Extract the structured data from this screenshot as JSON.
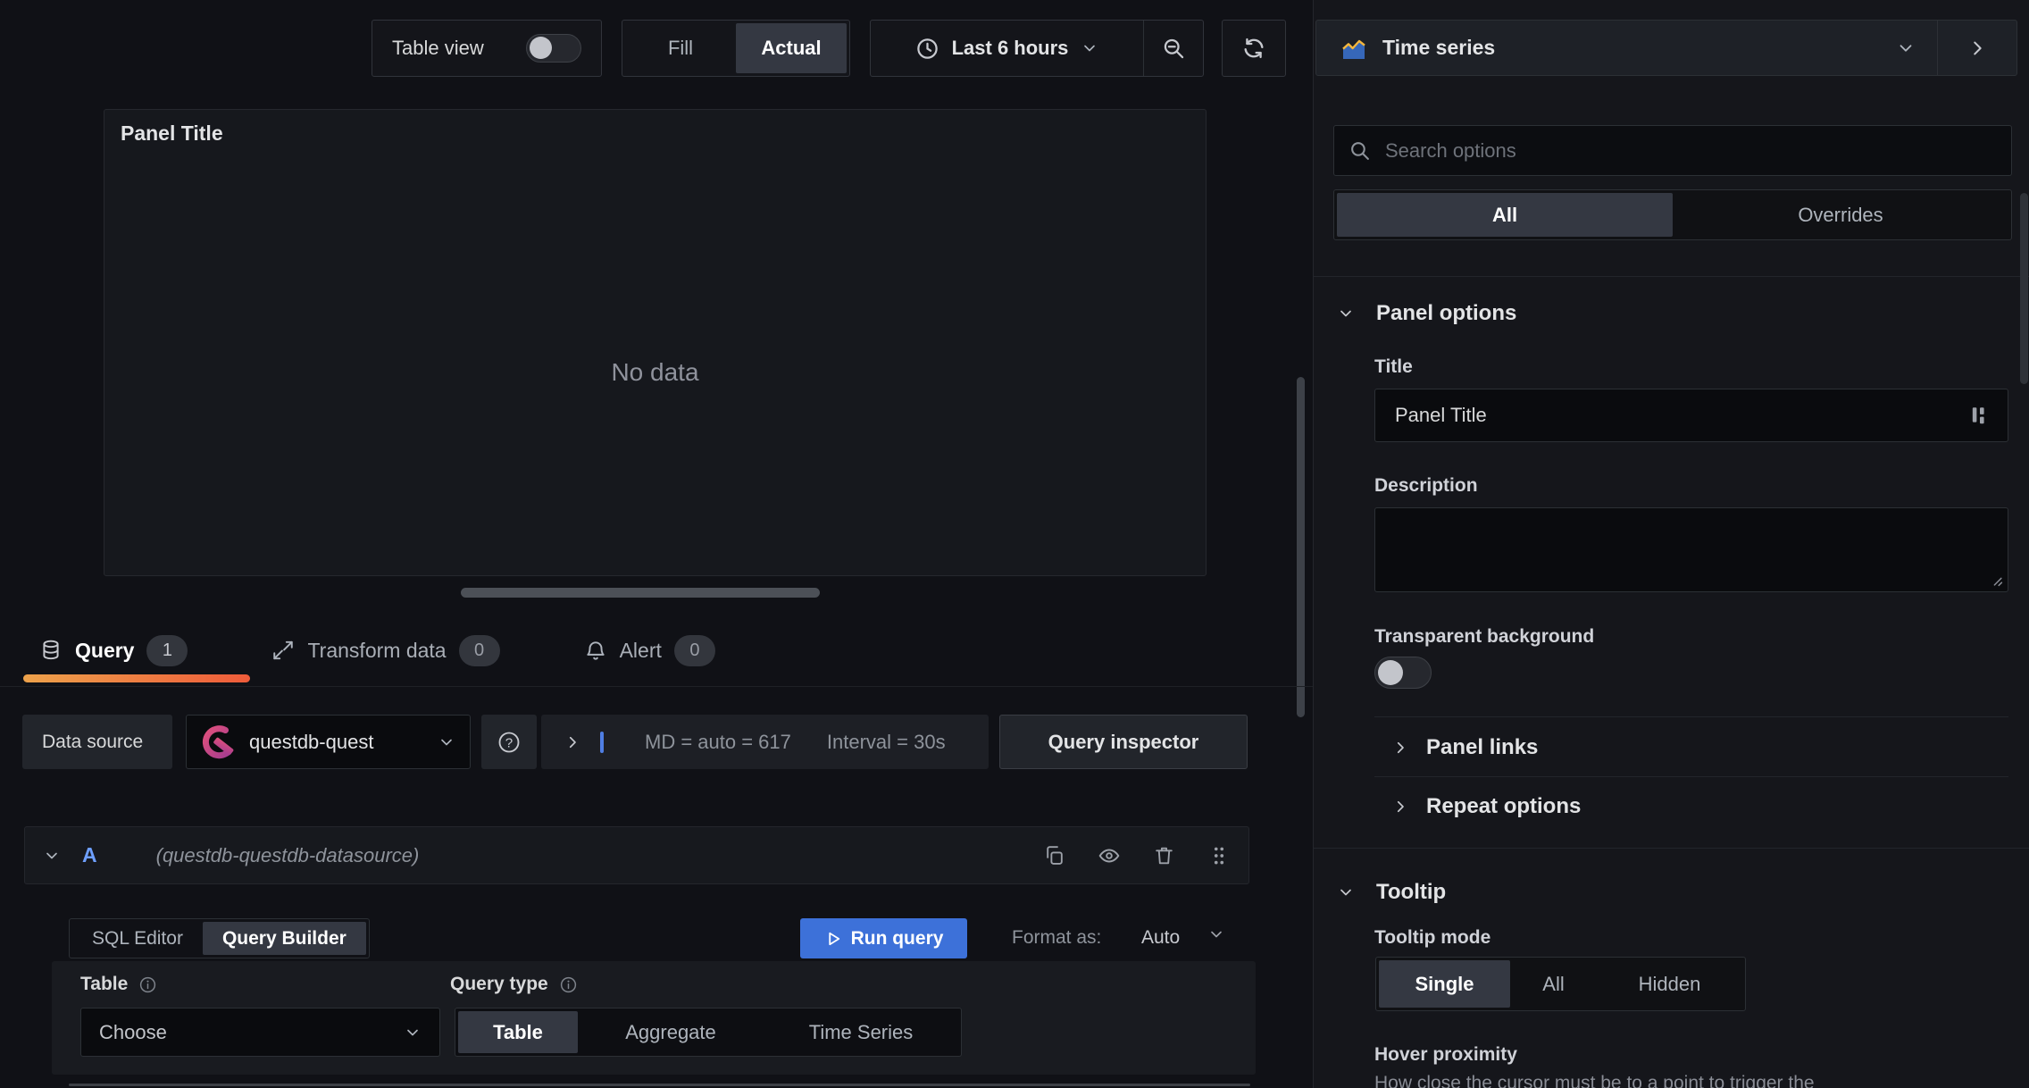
{
  "toolbar": {
    "table_view_label": "Table view",
    "fill_label": "Fill",
    "actual_label": "Actual",
    "time_range_label": "Last 6 hours"
  },
  "viz_picker": {
    "label": "Time series"
  },
  "panel": {
    "title": "Panel Title",
    "no_data": "No data"
  },
  "tabs": [
    {
      "label": "Query",
      "count": "1"
    },
    {
      "label": "Transform data",
      "count": "0"
    },
    {
      "label": "Alert",
      "count": "0"
    }
  ],
  "datasource_row": {
    "label": "Data source",
    "datasource_name": "questdb-quest",
    "stats": {
      "max_data_points": "MD = auto = 617",
      "interval": "Interval = 30s"
    },
    "query_inspector_label": "Query inspector"
  },
  "query_row": {
    "ref_id": "A",
    "datasource_hint": "(questdb-questdb-datasource)"
  },
  "query_editor": {
    "mode_options": [
      "SQL Editor",
      "Query Builder"
    ],
    "selected_mode": "Query Builder",
    "run_query_label": "Run query",
    "format_as_label": "Format as:",
    "format_value": "Auto",
    "table_label": "Table",
    "table_value": "Choose",
    "query_type_label": "Query type",
    "query_type_options": [
      "Table",
      "Aggregate",
      "Time Series"
    ],
    "selected_query_type": "Table"
  },
  "options_pane": {
    "search_placeholder": "Search options",
    "filter_tabs": [
      "All",
      "Overrides"
    ],
    "selected_filter": "All",
    "panel_options": {
      "header": "Panel options",
      "title_label": "Title",
      "title_value": "Panel Title",
      "description_label": "Description",
      "transparent_label": "Transparent background"
    },
    "collapsed_sections": [
      "Panel links",
      "Repeat options"
    ],
    "tooltip": {
      "header": "Tooltip",
      "mode_label": "Tooltip mode",
      "mode_options": [
        "Single",
        "All",
        "Hidden"
      ],
      "selected_mode": "Single",
      "hover_label": "Hover proximity",
      "hover_description": "How close the cursor must be to a point to trigger the"
    }
  },
  "colors": {
    "accent_blue": "#3d71d9",
    "ref_id_blue": "#6e9fff",
    "active_tab_gradient": [
      "#eda24b",
      "#ee5b3a"
    ],
    "questdb_pink": "#d94671",
    "background": "#101116"
  }
}
